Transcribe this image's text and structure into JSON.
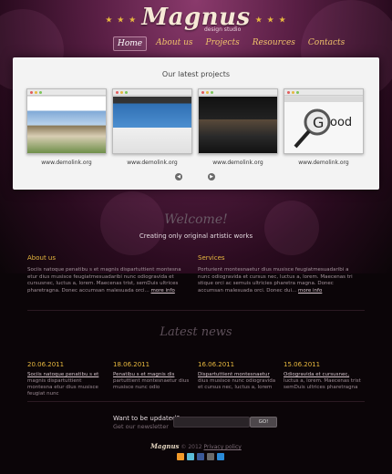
{
  "brand": {
    "name": "Magnus",
    "tagline": "design studio"
  },
  "nav": {
    "items": [
      "Home",
      "About us",
      "Projects",
      "Resources",
      "Contacts"
    ],
    "active": "Home"
  },
  "projects": {
    "heading": "Our latest projects",
    "items": [
      {
        "caption": "www.demolink.org"
      },
      {
        "caption": "www.demolink.org"
      },
      {
        "caption": "www.demolink.org"
      },
      {
        "caption": "www.demolink.org"
      }
    ]
  },
  "welcome": {
    "title": "Welcome!",
    "subtitle": "Creating only original artistic works"
  },
  "about": {
    "title": "About us",
    "text": "Sociis natoque penatibu s et magnis dispartuttient montesna etur dius musisce feugiatmesuadaribi nunc odiogravida et cursusnec, luctus a, lorem. Maecenas trist, semDuis ultrices pharetragna. Donec accumsan malesuada orci...",
    "more": "more info"
  },
  "services": {
    "title": "Services",
    "text": "Porturient montesnaetur dius musisce feugiatmesuadaribi a nunc odiogravida et cursus nec, luctus a, lorem. Maecenas tri stique orci ac semuis ultricies pharetra magna. Donec accumsan malesuada orci. Donec dui...",
    "more": "more info"
  },
  "news": {
    "title": "Latest news",
    "items": [
      {
        "date": "20.06.2011",
        "lead": "Sociis natoque penatibu s et",
        "text": "magnis dispartuttient montesna etur dius musisce feugiat nunc"
      },
      {
        "date": "18.06.2011",
        "lead": "Penatibu s et magnis dis",
        "text": "partuttient montesnaetur dius musisce nunc odio"
      },
      {
        "date": "16.06.2011",
        "lead": "Dispartuttient montesnaetur",
        "text": "dius musisce nunc odiogravida et cursus nec, luctus a, lorem"
      },
      {
        "date": "15.06.2011",
        "lead": "Odiogravida et cursusnec,",
        "text": "luctus a, lorem. Maecenas trist semDuis ultrices pharetragna"
      }
    ]
  },
  "newsletter": {
    "title": "Want to be updated?",
    "subtitle": "Get our newsletter",
    "placeholder": "",
    "button": "GO!"
  },
  "footer": {
    "brand": "Magnus",
    "copyright": "© 2012",
    "privacy": "Privacy policy"
  },
  "colors": {
    "accent": "#e8b83f",
    "panel": "#f3f3f3",
    "background": "#0b0508"
  },
  "social": [
    "rss-icon",
    "twitter-icon",
    "facebook-icon",
    "myspace-icon",
    "flickr-icon"
  ]
}
